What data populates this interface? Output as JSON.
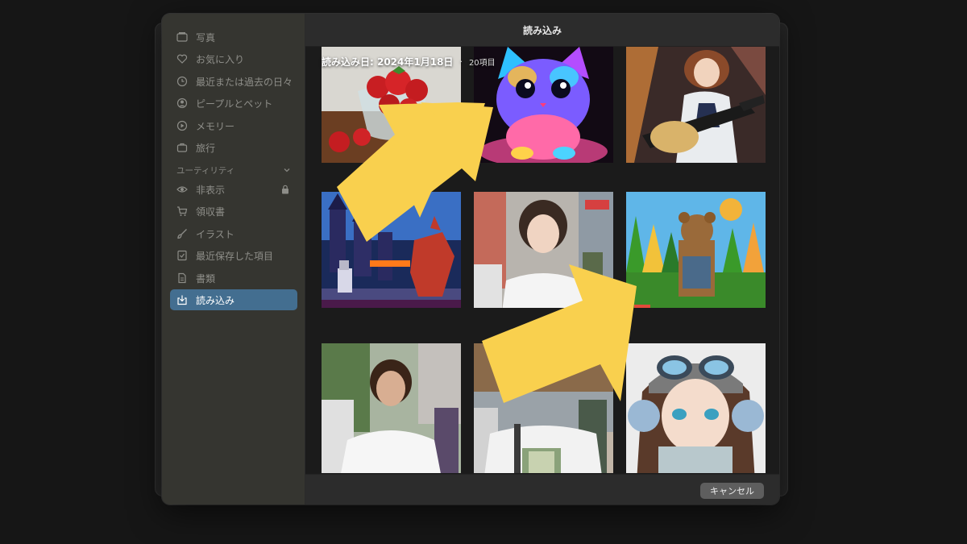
{
  "dialog": {
    "title": "読み込み"
  },
  "sidebar": {
    "items": [
      {
        "label": "写真",
        "icon": "photos-icon"
      },
      {
        "label": "お気に入り",
        "icon": "heart-icon"
      },
      {
        "label": "最近または過去の日々",
        "icon": "clock-icon"
      },
      {
        "label": "ピープルとペット",
        "icon": "person-icon"
      },
      {
        "label": "メモリー",
        "icon": "memories-icon"
      },
      {
        "label": "旅行",
        "icon": "suitcase-icon"
      }
    ],
    "section": {
      "label": "ユーティリティ"
    },
    "utility_items": [
      {
        "label": "非表示",
        "icon": "eye-icon"
      },
      {
        "label": "領収書",
        "icon": "cart-icon"
      },
      {
        "label": "イラスト",
        "icon": "brush-icon"
      },
      {
        "label": "最近保存した項目",
        "icon": "saved-icon"
      },
      {
        "label": "書類",
        "icon": "document-icon"
      },
      {
        "label": "読み込み",
        "icon": "import-icon"
      }
    ]
  },
  "grid": {
    "header_title": "読み込み日: 2024年1月18日",
    "header_separator": "·",
    "item_count": "20項目",
    "thumbnails": [
      "strawberries-photo",
      "rainbow-kitten-illustration",
      "anime-guitarist-illustration",
      "pixel-knight-dragon-illustration",
      "woman-street-photo",
      "toy-brick-bear-illustration",
      "short-hair-woman-photo",
      "woman-tshirt-photo",
      "anime-aviator-girl-illustration"
    ]
  },
  "footer": {
    "cancel_label": "キャンセル"
  },
  "colors": {
    "accent": "#3f6f94",
    "arrow": "#f9d04e"
  }
}
